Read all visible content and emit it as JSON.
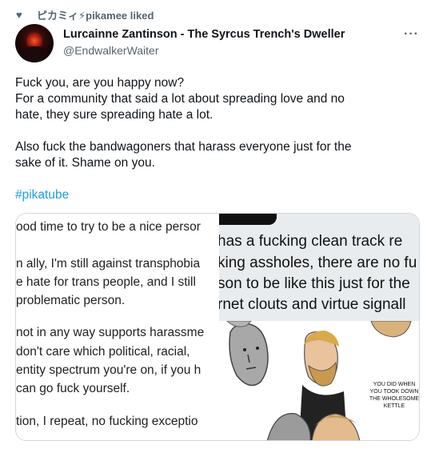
{
  "social_context": {
    "icon": "heart-icon",
    "text": "ピカミィ⚡pikamee liked"
  },
  "author": {
    "display_name": "Lurcainne Zantinson - The Syrcus Trench's Dweller",
    "handle": "@EndwalkerWaiter"
  },
  "more_icon": "more-icon",
  "tweet": {
    "lines": [
      "Fuck you, are you happy now?",
      "For a community that said a lot about spreading love and no",
      "hate, they sure spreading hate a lot.",
      "",
      "Also fuck the bandwagoners that harass everyone just for the",
      "sake of it. Shame on you.",
      ""
    ],
    "hashtag": "#pikatube"
  },
  "media": {
    "left_image_lines": [
      "ood time to try to be a nice persor",
      "",
      "n ally, I'm still against transphobia",
      "e hate for trans people, and I still",
      "problematic person.",
      "",
      "not in any way supports harassme",
      "don't care which political, racial,",
      "entity spectrum you're on, if you h",
      "can go fuck yourself.",
      "",
      "tion, I repeat, no fucking exceptio"
    ],
    "right_image_lines": [
      "has a fucking clean track re",
      "king assholes, there are no fu",
      "son to be like this just for the",
      "rnet clouts and virtue signall"
    ],
    "meme_caption": "You did when you took down the wholesome kettle"
  }
}
